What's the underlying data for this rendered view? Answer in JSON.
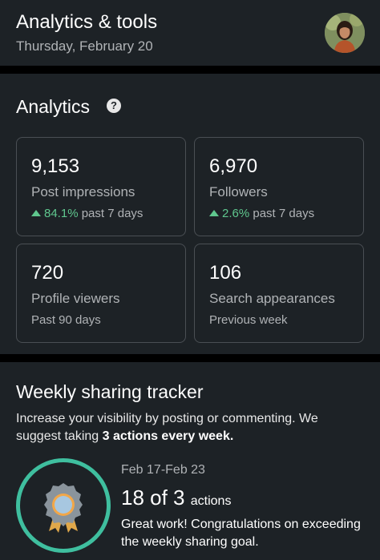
{
  "header": {
    "title": "Analytics & tools",
    "date": "Thursday, February 20"
  },
  "analytics": {
    "title": "Analytics",
    "help_icon": "question-circle-icon",
    "cards": [
      {
        "value": "9,153",
        "label": "Post impressions",
        "change": "84.1%",
        "period": "past 7 days",
        "trend": "up"
      },
      {
        "value": "6,970",
        "label": "Followers",
        "change": "2.6%",
        "period": "past 7 days",
        "trend": "up"
      },
      {
        "value": "720",
        "label": "Profile viewers",
        "period": "Past 90 days"
      },
      {
        "value": "106",
        "label": "Search appearances",
        "period": "Previous week"
      }
    ]
  },
  "tracker": {
    "title": "Weekly sharing tracker",
    "desc_prefix": "Increase your visibility by posting or commenting. We suggest taking ",
    "desc_bold": "3 actions every week.",
    "range": "Feb 17-Feb 23",
    "count": "18 of 3",
    "count_unit": "actions",
    "message": "Great work! Congratulations on exceeding the weekly sharing goal.",
    "badge_icon": "award-badge-icon"
  },
  "colors": {
    "background": "#1d2226",
    "positive": "#5fc78e",
    "ring": "#3fbf9f"
  }
}
